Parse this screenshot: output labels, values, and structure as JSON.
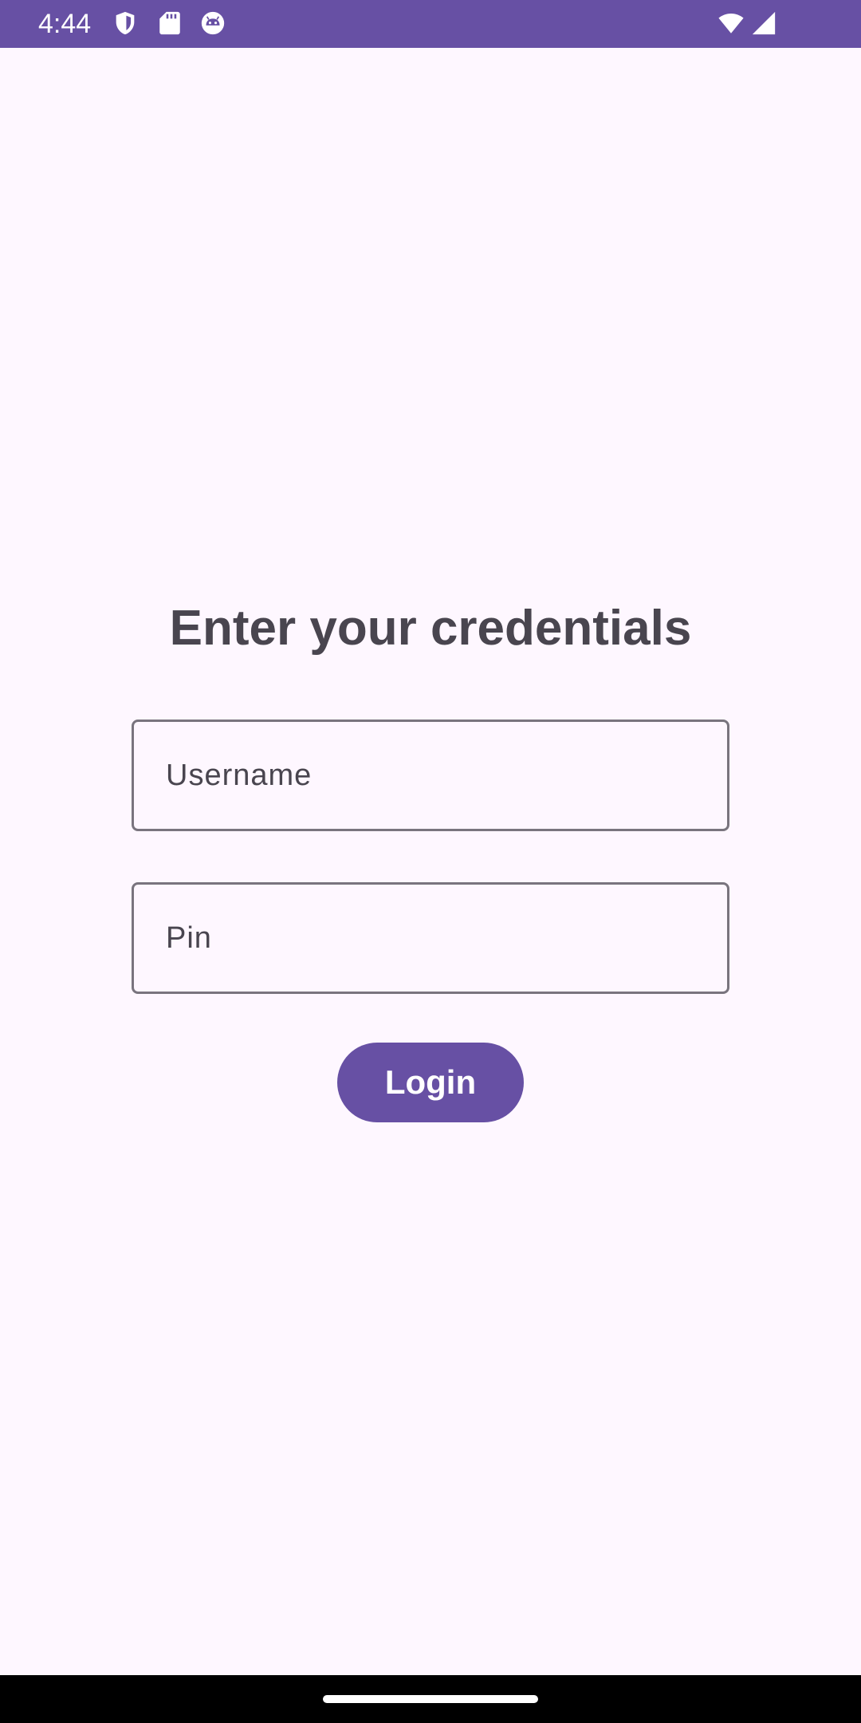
{
  "status_bar": {
    "time": "4:44",
    "icons": [
      "shield-icon",
      "sd-card-icon",
      "robot-face-icon",
      "wifi-icon",
      "cell-signal-icon"
    ],
    "background": "#6750A4"
  },
  "login": {
    "title": "Enter your credentials",
    "username_placeholder": "Username",
    "username_value": "",
    "pin_placeholder": "Pin",
    "pin_value": "",
    "button_label": "Login"
  },
  "colors": {
    "accent": "#6750A4",
    "background": "#FEF7FF",
    "text": "#49454F",
    "outline": "#79747E"
  }
}
